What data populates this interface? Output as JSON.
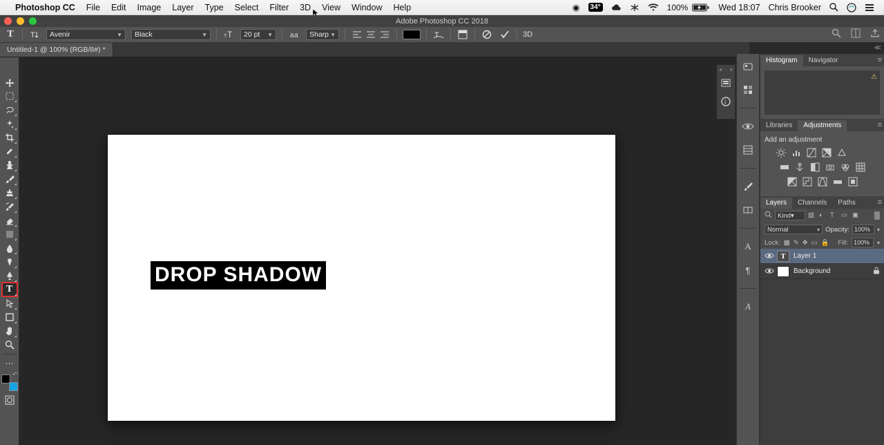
{
  "macmenu": {
    "app": "Photoshop CC",
    "items": [
      "File",
      "Edit",
      "Image",
      "Layer",
      "Type",
      "Select",
      "Filter",
      "3D",
      "View",
      "Window",
      "Help"
    ],
    "temp": "34°",
    "battery_pct": "100%",
    "clock": "Wed 18:07",
    "user": "Chris Brooker"
  },
  "window": {
    "title": "Adobe Photoshop CC 2018"
  },
  "options": {
    "font": "Avenir",
    "style": "Black",
    "size": "20 pt",
    "aa": "Sharp",
    "threeD": "3D"
  },
  "doc": {
    "tab": "Untitled-1 @ 100% (RGB/8#) *"
  },
  "canvas": {
    "text": "DROP SHADOW"
  },
  "panels": {
    "hist_tabs": [
      "Histogram",
      "Navigator"
    ],
    "adj_tabs": [
      "Libraries",
      "Adjustments"
    ],
    "adj_title": "Add an adjustment",
    "layer_tabs": [
      "Layers",
      "Channels",
      "Paths"
    ],
    "search_ph": "Kind",
    "blend": "Normal",
    "opacity_label": "Opacity:",
    "opacity": "100%",
    "lock_label": "Lock:",
    "fill_label": "Fill:",
    "fill": "100%",
    "layers": [
      {
        "name": "Layer 1",
        "type": "text",
        "locked": false
      },
      {
        "name": "Background",
        "type": "raster",
        "locked": true
      }
    ]
  }
}
